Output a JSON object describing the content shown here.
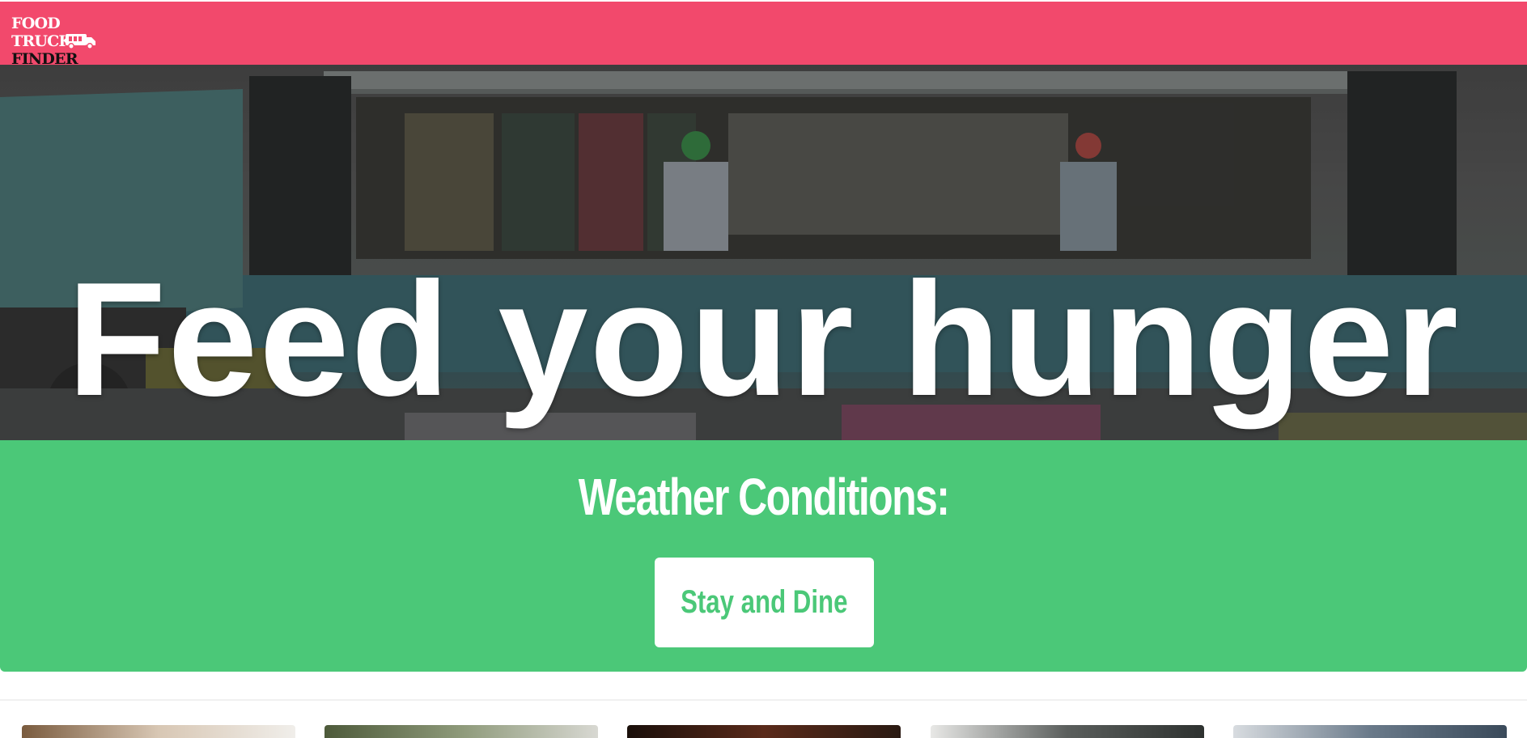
{
  "navbar": {
    "logo_line1": "FOOD TRUCK",
    "logo_line2": "FINDER",
    "brand_color": "#f2496c"
  },
  "hero": {
    "title": "Feed your hunger"
  },
  "weather": {
    "title": "Weather Conditions:",
    "button_label": "Stay and Dine",
    "accent_color": "#4bc878"
  },
  "cards": [
    {
      "name": "food-card-1"
    },
    {
      "name": "food-card-2"
    },
    {
      "name": "food-card-3"
    },
    {
      "name": "food-card-4"
    },
    {
      "name": "food-card-5"
    }
  ]
}
